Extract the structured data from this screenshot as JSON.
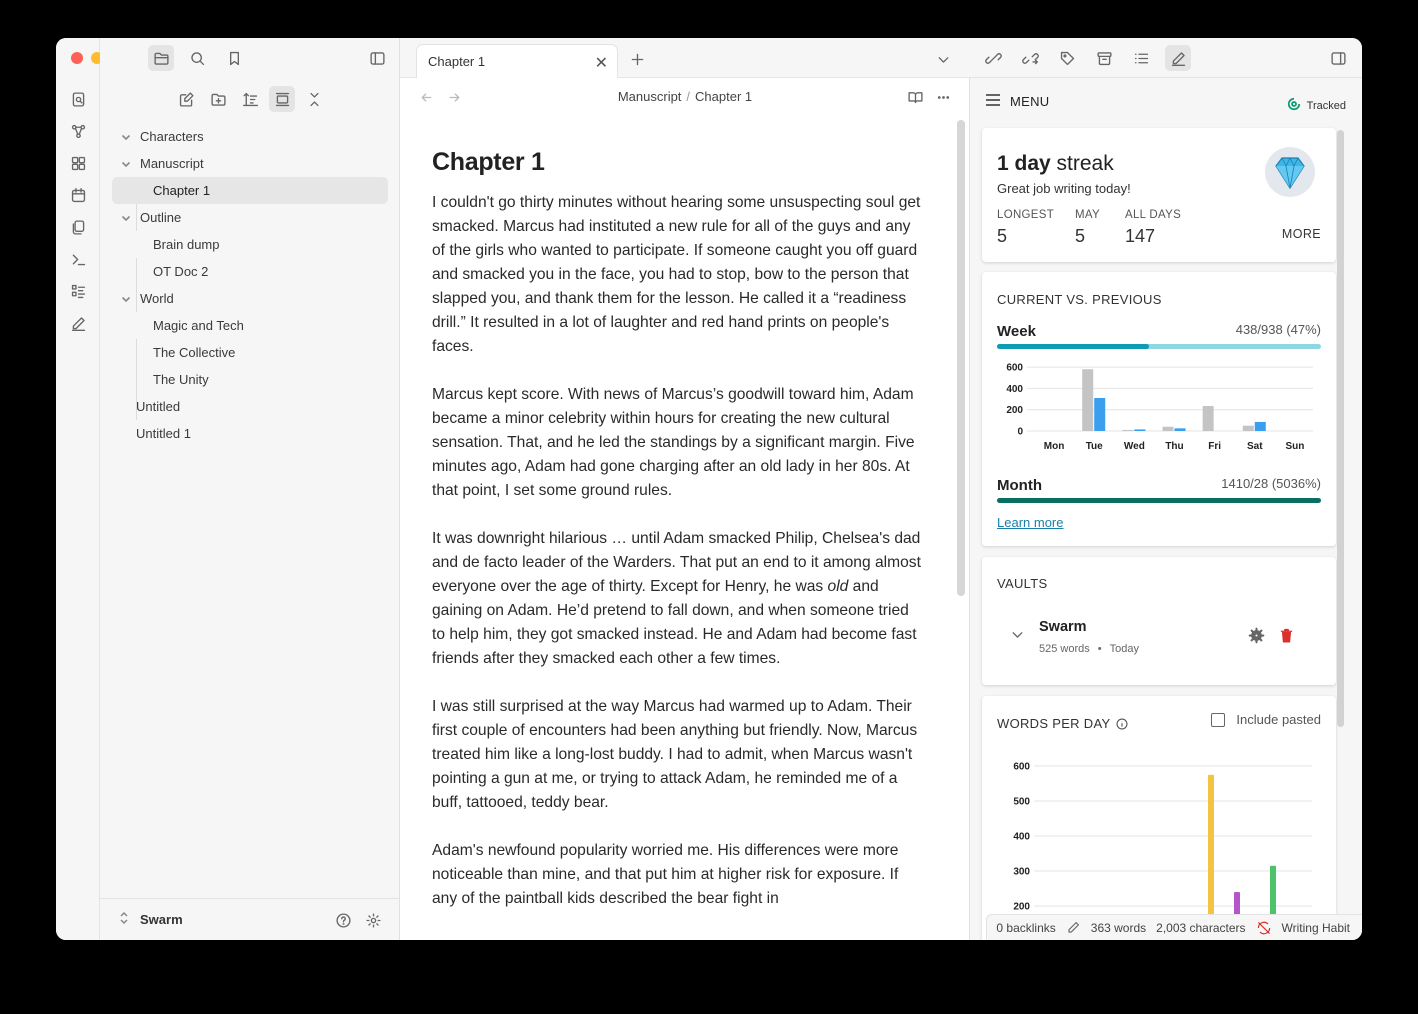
{
  "sidebar": {
    "tree": [
      {
        "label": "Characters"
      },
      {
        "label": "Manuscript"
      },
      {
        "label": "Chapter 1"
      },
      {
        "label": "Outline"
      },
      {
        "label": "Brain dump"
      },
      {
        "label": "OT Doc 2"
      },
      {
        "label": "World"
      },
      {
        "label": "Magic and Tech"
      },
      {
        "label": "The Collective"
      },
      {
        "label": "The Unity"
      },
      {
        "label": "Untitled"
      },
      {
        "label": "Untitled 1"
      }
    ],
    "vault": "Swarm",
    "icons": [
      "files-icon",
      "search-icon",
      "bookmark-icon",
      "new-note-icon",
      "new-folder-icon",
      "sort-icon",
      "collapse-icon"
    ]
  },
  "editor": {
    "tab_title": "Chapter 1",
    "breadcrumb": [
      "Manuscript",
      "Chapter 1"
    ],
    "heading": "Chapter 1",
    "paragraphs": [
      {
        "a": "I couldn't go thirty minutes without hearing some unsuspecting soul get smacked. Marcus had instituted a new rule for all of the guys and any of the girls who wanted to participate. If someone caught you off guard and smacked you in the face, you had to stop, bow to the person that slapped you, and thank them for the lesson. He called it a “readiness drill.” It resulted in a lot of laughter and red hand prints on people's faces."
      },
      {
        "a": "Marcus kept score. With news of Marcus’s goodwill toward him, Adam became a minor celebrity within hours for creating the new cultural sensation. That, and he led the standings by a significant margin. Five minutes ago, Adam had gone charging after an old lady in her 80s. At that point, I set some ground rules."
      },
      {
        "a": "It was downright hilarious …  until Adam smacked Philip, Chelsea's dad and de facto leader of the Warders. That put an end to it among almost everyone over the age of thirty. Except for Henry, he was ",
        "em": "old",
        "b": " and gaining on Adam. He’d pretend to fall down, and when someone tried to help him, they got smacked instead. He and Adam had become fast friends after they smacked each other a few times."
      },
      {
        "a": "I was still surprised at the way Marcus had warmed up to Adam. Their first couple of encounters had been anything but friendly. Now, Marcus treated him like a long-lost buddy. I had to admit, when Marcus wasn't pointing a gun at me, or trying to attack Adam, he reminded me of a buff, tattooed, teddy bear."
      },
      {
        "a": "Adam's newfound popularity worried me. His differences were more noticeable than mine, and that put him at higher risk for exposure. If any of the paintball kids described the bear fight in"
      }
    ]
  },
  "panel": {
    "menu": "MENU",
    "tracked": "Tracked",
    "streak": {
      "num": "1 day",
      "word": "streak",
      "sub": "Great job writing today!",
      "more": "MORE",
      "stats": [
        {
          "label": "LONGEST",
          "value": "5"
        },
        {
          "label": "MAY",
          "value": "5"
        },
        {
          "label": "ALL DAYS",
          "value": "147"
        }
      ]
    },
    "compare": {
      "title": "CURRENT VS. PREVIOUS",
      "week_label": "Week",
      "week_value": "438/938 (47%)",
      "week_fraction": 0.47,
      "month_label": "Month",
      "month_value": "1410/28 (5036%)",
      "month_fraction": 1.0,
      "learn_more": "Learn more"
    },
    "vaults": {
      "title": "VAULTS",
      "name": "Swarm",
      "words": "525 words",
      "dot": "•",
      "when": "Today"
    },
    "wpd": {
      "title": "WORDS PER DAY",
      "include_pasted": "Include pasted"
    },
    "colors": {
      "accent_teal": "#0e9bb4",
      "accent_light": "#8fd6e4",
      "month_green": "#0a6f62",
      "prev_gray": "#c4c4c4",
      "cur_blue": "#3b9ff0",
      "trash_red": "#d9302c"
    }
  },
  "status": {
    "backlinks": "0 backlinks",
    "words": "363 words",
    "chars": "2,003 characters",
    "habit": "Writing Habit"
  },
  "chart_data": [
    {
      "type": "bar",
      "title": "Week",
      "categories": [
        "Mon",
        "Tue",
        "Wed",
        "Thu",
        "Fri",
        "Sat",
        "Sun"
      ],
      "series": [
        {
          "values": [
            0,
            580,
            10,
            40,
            235,
            50,
            0
          ]
        },
        {
          "values": [
            0,
            310,
            15,
            25,
            0,
            85,
            0
          ]
        }
      ],
      "yticks": [
        0,
        200,
        400,
        600
      ],
      "ylim": [
        0,
        620
      ]
    },
    {
      "type": "bar",
      "title": "WORDS PER DAY",
      "yticks": [
        200,
        300,
        400,
        500,
        600
      ],
      "ylim": [
        200,
        600
      ],
      "series": [
        {
          "values": [
            575
          ],
          "color": "#f5c342"
        },
        {
          "values": [
            240
          ],
          "color": "#b455cc"
        },
        {
          "values": [
            315
          ],
          "color": "#4cc26a"
        }
      ]
    }
  ]
}
